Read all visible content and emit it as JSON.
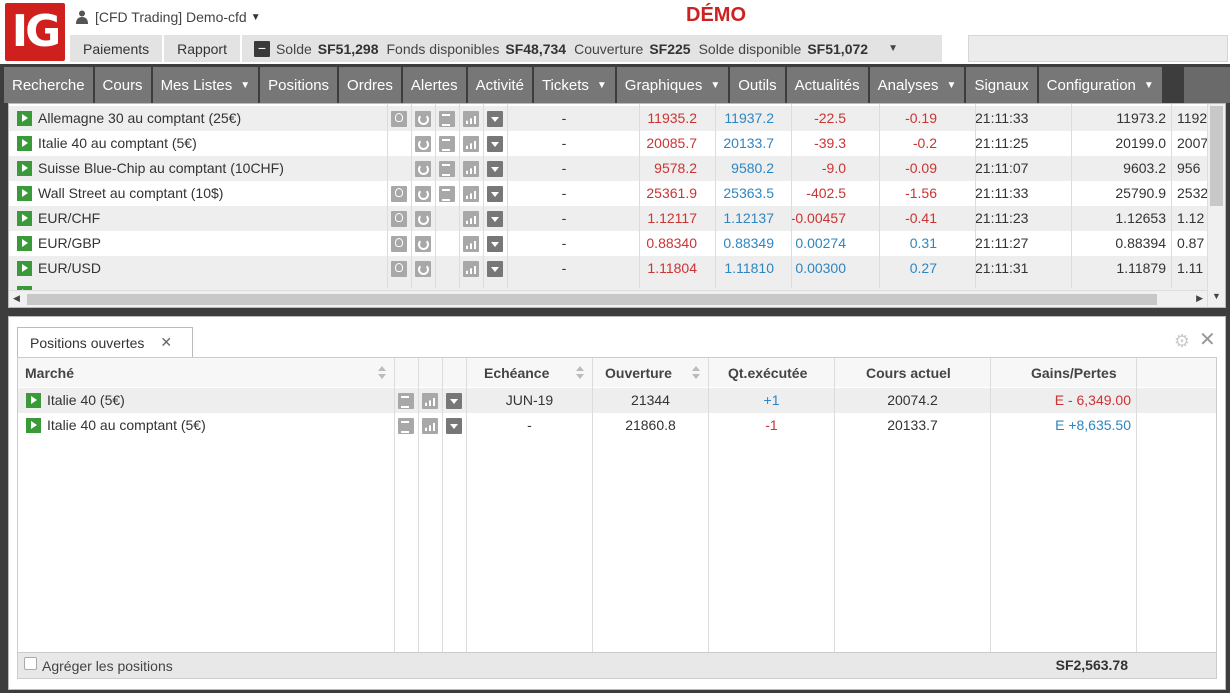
{
  "header": {
    "logo_text": "IG",
    "account_label": "[CFD Trading] Demo-cfd",
    "mode_label": "DÉMO",
    "tabs": [
      {
        "label": "Paiements"
      },
      {
        "label": "Rapport"
      }
    ],
    "balances": {
      "solde_label": "Solde",
      "solde_value": "SF51,298",
      "fonds_label": "Fonds disponibles",
      "fonds_value": "SF48,734",
      "couverture_label": "Couverture",
      "couverture_value": "SF225",
      "dispo_label": "Solde disponible",
      "dispo_value": "SF51,072"
    }
  },
  "nav": [
    {
      "label": "Recherche",
      "dropdown": false
    },
    {
      "label": "Cours",
      "dropdown": false
    },
    {
      "label": "Mes Listes",
      "dropdown": true
    },
    {
      "label": "Positions",
      "dropdown": false
    },
    {
      "label": "Ordres",
      "dropdown": false
    },
    {
      "label": "Alertes",
      "dropdown": false
    },
    {
      "label": "Activité",
      "dropdown": false
    },
    {
      "label": "Tickets",
      "dropdown": true
    },
    {
      "label": "Graphiques",
      "dropdown": true
    },
    {
      "label": "Outils",
      "dropdown": false
    },
    {
      "label": "Actualités",
      "dropdown": false
    },
    {
      "label": "Analyses",
      "dropdown": true
    },
    {
      "label": "Signaux",
      "dropdown": false
    },
    {
      "label": "Configuration",
      "dropdown": true
    }
  ],
  "markets": [
    {
      "name": "Allemagne 30 au comptant (25€)",
      "dash": "-",
      "sell": "11935.2",
      "buy": "11937.2",
      "change": "-22.5",
      "pct": "-0.19",
      "time": "21:11:33",
      "high": "11973.2",
      "low": "1192",
      "change_color": "red",
      "icons": [
        "bulb",
        "refresh",
        "doc",
        "chart",
        "dd"
      ]
    },
    {
      "name": "Italie 40 au comptant (5€)",
      "dash": "-",
      "sell": "20085.7",
      "buy": "20133.7",
      "change": "-39.3",
      "pct": "-0.2",
      "time": "21:11:25",
      "high": "20199.0",
      "low": "2007",
      "change_color": "red",
      "icons": [
        "refresh",
        "doc",
        "chart",
        "dd"
      ]
    },
    {
      "name": "Suisse Blue-Chip au comptant (10CHF)",
      "dash": "-",
      "sell": "9578.2",
      "buy": "9580.2",
      "change": "-9.0",
      "pct": "-0.09",
      "time": "21:11:07",
      "high": "9603.2",
      "low": "956",
      "change_color": "red",
      "icons": [
        "refresh",
        "doc",
        "chart",
        "dd"
      ]
    },
    {
      "name": "Wall Street au comptant (10$)",
      "dash": "-",
      "sell": "25361.9",
      "buy": "25363.5",
      "change": "-402.5",
      "pct": "-1.56",
      "time": "21:11:33",
      "high": "25790.9",
      "low": "2532",
      "change_color": "red",
      "icons": [
        "bulb",
        "refresh",
        "doc",
        "chart",
        "dd"
      ]
    },
    {
      "name": "EUR/CHF",
      "dash": "-",
      "sell": "1.12117",
      "buy": "1.12137",
      "change": "-0.00457",
      "pct": "-0.41",
      "time": "21:11:23",
      "high": "1.12653",
      "low": "1.12",
      "change_color": "red",
      "icons": [
        "bulb",
        "refresh",
        "chart",
        "dd"
      ]
    },
    {
      "name": "EUR/GBP",
      "dash": "-",
      "sell": "0.88340",
      "buy": "0.88349",
      "change": "0.00274",
      "pct": "0.31",
      "time": "21:11:27",
      "high": "0.88394",
      "low": "0.87",
      "change_color": "blue",
      "icons": [
        "bulb",
        "refresh",
        "chart",
        "dd"
      ]
    },
    {
      "name": "EUR/USD",
      "dash": "-",
      "sell": "1.11804",
      "buy": "1.11810",
      "change": "0.00300",
      "pct": "0.27",
      "time": "21:11:31",
      "high": "1.11879",
      "low": "1.11",
      "change_color": "blue",
      "icons": [
        "bulb",
        "refresh",
        "chart",
        "dd"
      ]
    }
  ],
  "positions_panel": {
    "tab_label": "Positions ouvertes",
    "columns": {
      "market": "Marché",
      "expiry": "Echéance",
      "open": "Ouverture",
      "qty": "Qt.exécutée",
      "current": "Cours actuel",
      "pnl": "Gains/Pertes"
    },
    "rows": [
      {
        "market": "Italie 40 (5€)",
        "expiry": "JUN-19",
        "open": "21344",
        "qty": "+1",
        "qty_color": "blue",
        "current": "20074.2",
        "pnl": "E - 6,349.00",
        "pnl_color": "red"
      },
      {
        "market": "Italie 40 au comptant (5€)",
        "expiry": "-",
        "open": "21860.8",
        "qty": "-1",
        "qty_color": "red",
        "current": "20133.7",
        "pnl": "E +8,635.50",
        "pnl_color": "blue"
      }
    ],
    "footer": {
      "aggregate_label": "Agréger les positions",
      "total": "SF2,563.78"
    }
  },
  "colors": {
    "brand_red": "#d0201e",
    "loss_red": "#cc3333",
    "gain_blue": "#2e86c1",
    "nav_grey": "#777777"
  }
}
